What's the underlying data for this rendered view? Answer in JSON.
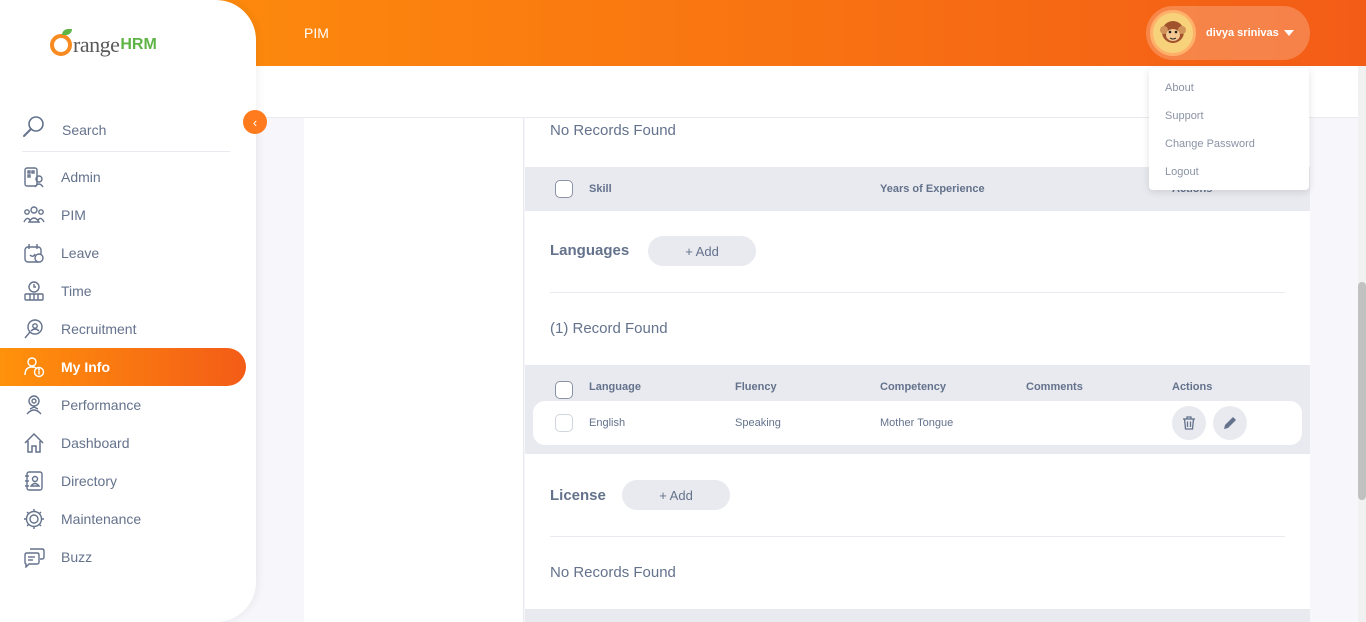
{
  "header": {
    "module": "PIM",
    "user_name": "divya srinivas"
  },
  "user_menu": [
    "About",
    "Support",
    "Change Password",
    "Logout"
  ],
  "logo": {
    "word": "rangeHRM",
    "o": "O",
    "text": "range",
    "brand": "HRM"
  },
  "sidebar": {
    "search_label": "Search",
    "items": [
      {
        "label": "Admin",
        "icon": "admin-icon"
      },
      {
        "label": "PIM",
        "icon": "pim-icon"
      },
      {
        "label": "Leave",
        "icon": "leave-icon"
      },
      {
        "label": "Time",
        "icon": "time-icon"
      },
      {
        "label": "Recruitment",
        "icon": "recruitment-icon"
      },
      {
        "label": "My Info",
        "icon": "my-info-icon",
        "active": true
      },
      {
        "label": "Performance",
        "icon": "performance-icon"
      },
      {
        "label": "Dashboard",
        "icon": "dashboard-icon"
      },
      {
        "label": "Directory",
        "icon": "directory-icon"
      },
      {
        "label": "Maintenance",
        "icon": "maintenance-icon"
      },
      {
        "label": "Buzz",
        "icon": "buzz-icon"
      }
    ]
  },
  "skills": {
    "status": "No Records Found",
    "columns": [
      "Skill",
      "Years of Experience",
      "Actions"
    ]
  },
  "languages": {
    "title": "Languages",
    "add_label": "+ Add",
    "status": "(1) Record Found",
    "columns": [
      "Language",
      "Fluency",
      "Competency",
      "Comments",
      "Actions"
    ],
    "rows": [
      {
        "language": "English",
        "fluency": "Speaking",
        "competency": "Mother Tongue",
        "comments": ""
      }
    ]
  },
  "license": {
    "title": "License",
    "add_label": "+ Add",
    "status": "No Records Found"
  },
  "colors": {
    "accent": "#ff7b1d",
    "gradient_start": "#ff920b",
    "gradient_end": "#f35c17",
    "text": "#64728c"
  }
}
